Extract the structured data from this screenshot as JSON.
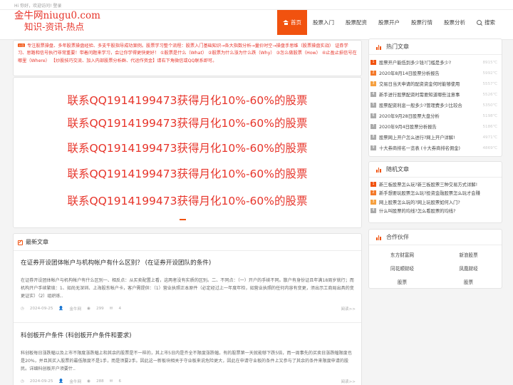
{
  "topbar": {
    "greeting": "Hi 你好，欢迎访问!",
    "login": "登录"
  },
  "logo": {
    "line1": "金牛网niugu0.com",
    "line2": "知识-资讯-热点"
  },
  "colors": {
    "accent": "#f1520f",
    "red_text": "#e7352b"
  },
  "nav": [
    {
      "label": "首页",
      "icon": "home-icon",
      "active": true
    },
    {
      "label": "股票入门"
    },
    {
      "label": "股票配资"
    },
    {
      "label": "股票开户"
    },
    {
      "label": "股票行情"
    },
    {
      "label": "股票分析"
    },
    {
      "label": "搜索",
      "icon": "search-icon"
    }
  ],
  "notice": {
    "tag": "公告",
    "text": "专注股票操盘、多年股票操盘经验、多支牛股指导成功案例。股票学习整个流程：股票入门基础知识→各大指数分析→量价时空→操盘手思维（股票操盘实战） 证券学习、思路和信号执行非常重要！带着问题来学习，会让你学得更快更好！ ①股票是什么（What） ②股票为什么涨为什么跌（Why） ③怎么做股票（How） ④止盈止损信号在哪里（Where） 【炒股技巧交流、加入内部股票分析群、代运作资金】请右下角微信或QQ联系即可。"
  },
  "promo_lines": [
    "联系QQ1914199473获得月化10%-60%的股票",
    "联系QQ1914199473获得月化10%-60%的股票",
    "联系QQ1914199473获得月化10%-60%的股票",
    "联系QQ1914199473获得月化10%-60%的股票",
    "联系QQ1914199473获得月化10%-60%的股票"
  ],
  "latest": {
    "title": "最新文章",
    "articles": [
      {
        "title": "在证券开设团体帐户与机构帐户有什么区别？ (在证券开设团队的条件)",
        "excerpt": "在证券开设团体帐户与机构帐户有什么区别一、相反点：从买卖配置上看，这两者没有实质的区别。二、不同点：（一）开户的手续不同。散户有身份证且年满18周岁就行；而机构开户手续繁琐：1、如尚无深圳、上海股东帐户卡，客户需提供：（1）营业执照正本原件（必定经过上一年度年检，如营业执照的任何内容有变更，须出示工商局出具的变更证实）（2）组织练..",
        "date": "2024-09-25",
        "author": "金牛网",
        "views": "299",
        "comments": "4",
        "read_more": "阅读>>"
      },
      {
        "title": "科创板开户条件 (科创板开户条件和要求)",
        "excerpt": "科创板每日涨跌幅以及上市不限度涨跌幅上和其余的股票是不一样的，其上市5日内是齐全不限度涨跌幅，有的股票第一天就能够下跌5倍，而一周事先的买卖日涨跌幅限度也是20%，并且其买入股票的最低限度不是1手，而是须要2手。因此这一新板块相关于守业板来说危险更大，因此在申请守业板的条件上又参与了其余的条件来限度申请的股民。详细科创板开户须要什..",
        "date": "2024-09-25",
        "author": "金牛网",
        "views": "288",
        "comments": "6",
        "read_more": "阅读>>"
      }
    ]
  },
  "hot": {
    "title": "热门文章",
    "items": [
      {
        "rank": "1",
        "title": "股票开户能低到多少钱?门槛是多少?",
        "views": "8915℃"
      },
      {
        "rank": "2",
        "title": "2020年8月14日股票分析报告",
        "views": "5992℃"
      },
      {
        "rank": "3",
        "title": "交易日当天申请的配资资金何时能够使用",
        "views": "5557℃"
      },
      {
        "rank": "4",
        "title": "新手进行股票配资时需要知道哪些注意事",
        "views": "5526℃"
      },
      {
        "rank": "5",
        "title": "股票配资利息一般多少?管理费多少比较合",
        "views": "5350℃"
      },
      {
        "rank": "6",
        "title": "2020年9月28日股票大盘分析",
        "views": "5198℃"
      },
      {
        "rank": "7",
        "title": "2020年9月4日股票分析报告",
        "views": "5186℃"
      },
      {
        "rank": "8",
        "title": "股票网上开户怎么进行?网上开户详解!",
        "views": "4971℃"
      },
      {
        "rank": "9",
        "title": "十大券商排名一览表 (十大券商排名佣金)",
        "views": "4869℃"
      }
    ]
  },
  "random": {
    "title": "随机文章",
    "items": [
      {
        "rank": "1",
        "title": "新三板股票怎么玩?新三板股票三种交易方式详解!"
      },
      {
        "rank": "2",
        "title": "新手想要玩股票怎么玩?投资金融股票怎么玩才会赚"
      },
      {
        "rank": "3",
        "title": "网上股票怎么玩的?网上玩股票如何入门?"
      },
      {
        "rank": "4",
        "title": "什么叫股票的均线?怎么看股票的均线?"
      }
    ]
  },
  "partners": {
    "title": "合作伙伴",
    "items": [
      "东方财富网",
      "新浪股票",
      "同花顺财经",
      "凤凰财经",
      "股票",
      "股票"
    ]
  }
}
